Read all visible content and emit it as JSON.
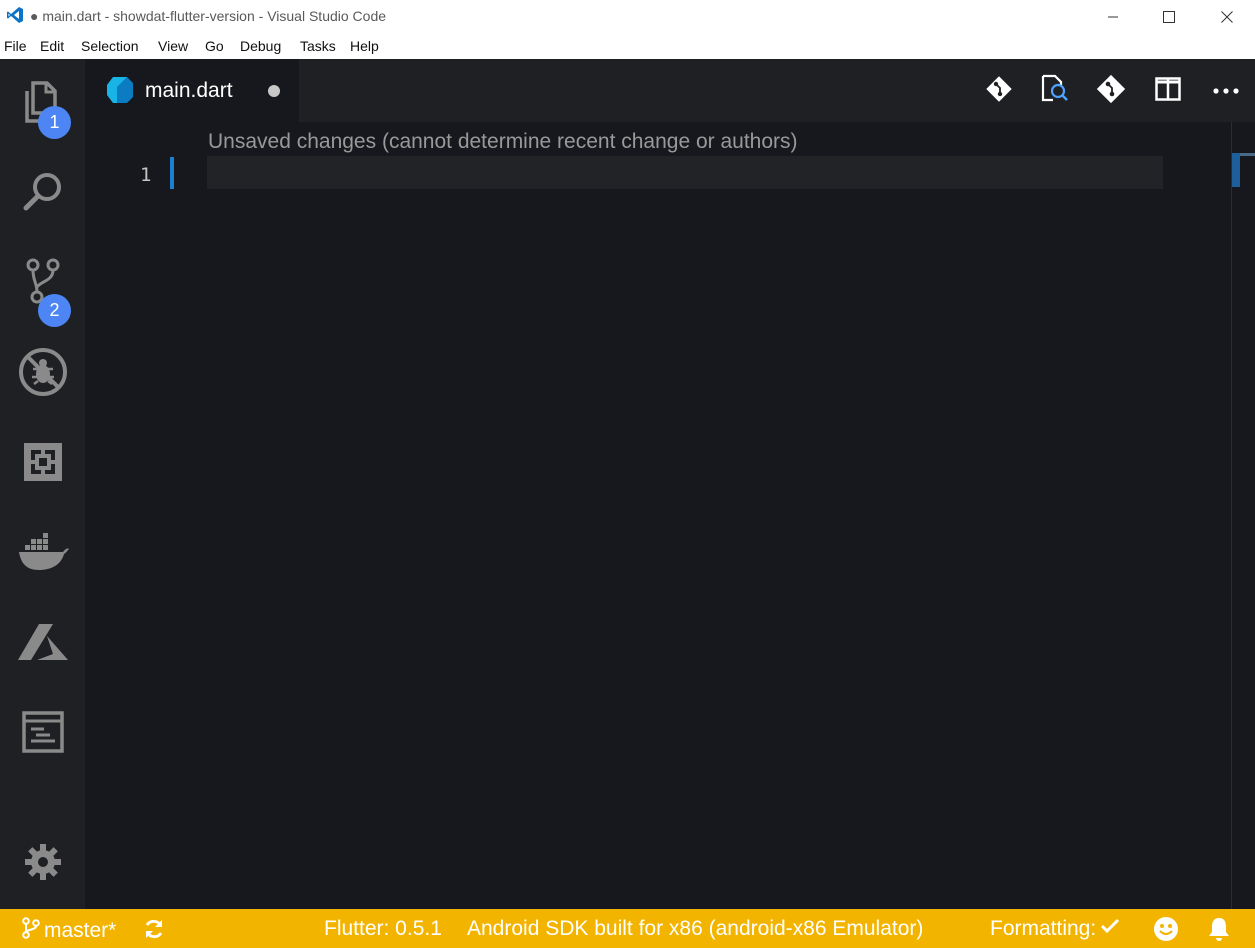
{
  "window": {
    "title": "● main.dart - showdat-flutter-version - Visual Studio Code",
    "controls": [
      "minimize",
      "maximize",
      "close"
    ]
  },
  "menu": {
    "items": [
      "File",
      "Edit",
      "Selection",
      "View",
      "Go",
      "Debug",
      "Tasks",
      "Help"
    ]
  },
  "activity_bar": {
    "items": [
      {
        "name": "explorer",
        "icon": "files-icon",
        "badge": "1"
      },
      {
        "name": "search",
        "icon": "search-icon",
        "badge": ""
      },
      {
        "name": "source-control",
        "icon": "source-control-icon",
        "badge": "2"
      },
      {
        "name": "debug",
        "icon": "debug-disabled-icon",
        "badge": ""
      },
      {
        "name": "extensions",
        "icon": "extensions-icon",
        "badge": ""
      },
      {
        "name": "docker",
        "icon": "docker-icon",
        "badge": ""
      },
      {
        "name": "azure",
        "icon": "azure-icon",
        "badge": ""
      },
      {
        "name": "output",
        "icon": "output-panel-icon",
        "badge": ""
      }
    ],
    "manage_icon": "gear-icon"
  },
  "tabs": [
    {
      "label": "main.dart",
      "icon": "dart-file-icon",
      "dirty": true
    }
  ],
  "editor_actions": [
    "git-diff-icon",
    "find-in-file-icon",
    "git-icon",
    "split-editor-icon",
    "more-actions-icon"
  ],
  "editor": {
    "codelens": "Unsaved changes (cannot determine recent change or authors)",
    "line_numbers": [
      "1"
    ],
    "lines": [
      ""
    ]
  },
  "status_bar": {
    "branch": "master*",
    "flutter_version": "Flutter: 0.5.1",
    "device": "Android SDK built for x86 (android-x86 Emulator)",
    "formatting": "Formatting:"
  },
  "colors": {
    "accent_blue": "#1c7fd0",
    "status_bar": "#f3b400",
    "badge": "#4d86f4",
    "editor_bg": "#17181d"
  }
}
